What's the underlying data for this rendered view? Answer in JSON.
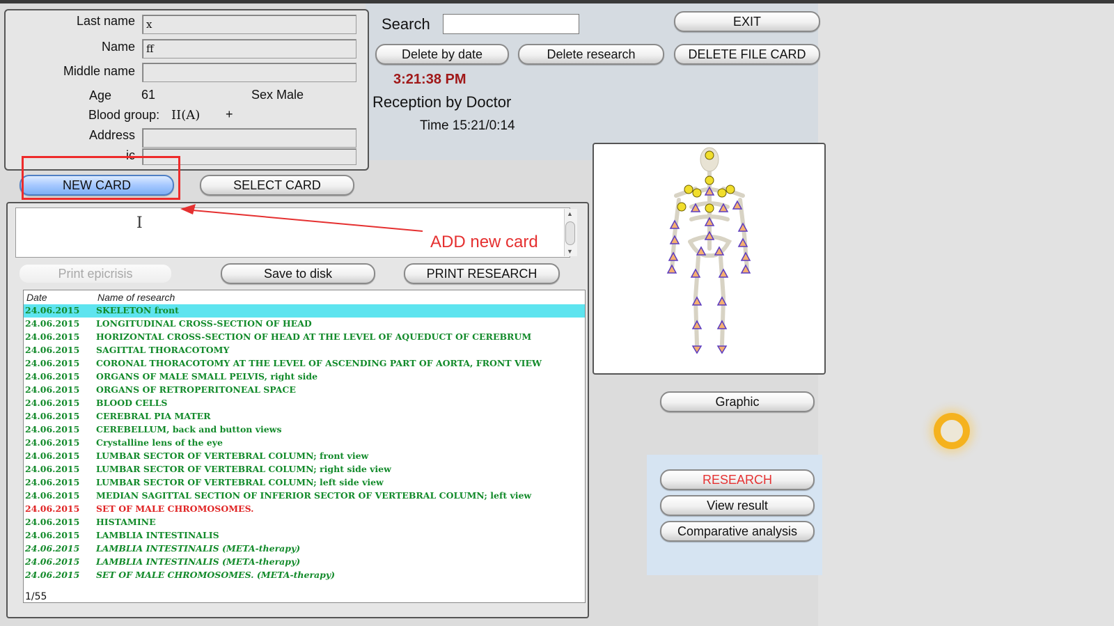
{
  "patient": {
    "last_name_label": "Last name",
    "last_name_value": "x",
    "name_label": "Name",
    "name_value": "ff",
    "middle_name_label": "Middle name",
    "middle_name_value": "",
    "age_label": "Age",
    "age_value": "61",
    "sex_text": "Sex Male",
    "blood_group_label": "Blood group:",
    "blood_group_value": "II(A)",
    "rh_value": "+",
    "address_label": "Address",
    "address_value": "",
    "truncated_label": "ic"
  },
  "search": {
    "label": "Search",
    "value": ""
  },
  "buttons": {
    "exit": "EXIT",
    "delete_by_date": "Delete by date",
    "delete_research": "Delete research",
    "delete_file_card": "DELETE FILE CARD",
    "new_card": "NEW CARD",
    "select_card": "SELECT CARD",
    "print_epicrisis": "Print epicrisis",
    "save_to_disk": "Save to disk",
    "print_research": "PRINT RESEARCH",
    "graphic": "Graphic",
    "research": "RESEARCH",
    "view_result": "View result",
    "comparative_analysis": "Comparative analysis"
  },
  "status": {
    "clock": "3:21:38 PM",
    "reception": "Reception by Doctor",
    "time": "Time 15:21/0:14"
  },
  "annotation": {
    "text": "ADD new card",
    "color": "#e53030"
  },
  "research_list": {
    "header_date": "Date",
    "header_name": "Name of research",
    "counter": "1/55",
    "rows": [
      {
        "date": "24.06.2015",
        "name": "SKELETON front",
        "style": "selected"
      },
      {
        "date": "24.06.2015",
        "name": "LONGITUDINAL CROSS-SECTION OF HEAD",
        "style": "normal"
      },
      {
        "date": "24.06.2015",
        "name": "HORIZONTAL CROSS-SECTION OF HEAD AT THE LEVEL OF AQUEDUCT OF CEREBRUM",
        "style": "normal"
      },
      {
        "date": "24.06.2015",
        "name": "SAGITTAL THORACOTOMY",
        "style": "normal"
      },
      {
        "date": "24.06.2015",
        "name": "CORONAL THORACOTOMY AT THE LEVEL OF ASCENDING PART OF AORTA, FRONT VIEW",
        "style": "normal"
      },
      {
        "date": "24.06.2015",
        "name": "ORGANS OF MALE SMALL PELVIS, right side",
        "style": "normal"
      },
      {
        "date": "24.06.2015",
        "name": "ORGANS OF RETROPERITONEAL SPACE",
        "style": "normal"
      },
      {
        "date": "24.06.2015",
        "name": "BLOOD  CELLS",
        "style": "normal"
      },
      {
        "date": "24.06.2015",
        "name": "CEREBRAL  PIA  MATER",
        "style": "normal"
      },
      {
        "date": "24.06.2015",
        "name": "CEREBELLUM,  back  and button  views",
        "style": "normal"
      },
      {
        "date": "24.06.2015",
        "name": "Crystalline lens of the eye",
        "style": "normal"
      },
      {
        "date": "24.06.2015",
        "name": "LUMBAR  SECTOR  OF  VERTEBRAL  COLUMN; front view",
        "style": "normal"
      },
      {
        "date": "24.06.2015",
        "name": "LUMBAR  SECTOR  OF  VERTEBRAL  COLUMN; right side view",
        "style": "normal"
      },
      {
        "date": "24.06.2015",
        "name": "LUMBAR  SECTOR  OF  VERTEBRAL  COLUMN; left side view",
        "style": "normal"
      },
      {
        "date": "24.06.2015",
        "name": "MEDIAN SAGITTAL SECTION OF INFERIOR SECTOR OF VERTEBRAL COLUMN; left view",
        "style": "normal"
      },
      {
        "date": "24.06.2015",
        "name": "SET OF MALE CHROMOSOMES.",
        "style": "red"
      },
      {
        "date": "24.06.2015",
        "name": "HISTAMINE",
        "style": "normal"
      },
      {
        "date": "24.06.2015",
        "name": "LAMBLIA  INTESTINALIS",
        "style": "normal"
      },
      {
        "date": "24.06.2015",
        "name": "LAMBLIA  INTESTINALIS (META-therapy)",
        "style": "italic"
      },
      {
        "date": "24.06.2015",
        "name": "LAMBLIA  INTESTINALIS (META-therapy)",
        "style": "italic"
      },
      {
        "date": "24.06.2015",
        "name": "SET OF MALE CHROMOSOMES. (META-therapy)",
        "style": "italic"
      }
    ]
  },
  "colors": {
    "row_text": "#128a2a",
    "row_selected_bg": "#5ee4ef",
    "row_red": "#e02424",
    "clock": "#a01818",
    "research_label": "#e53333",
    "annotation": "#ee2b2b"
  }
}
